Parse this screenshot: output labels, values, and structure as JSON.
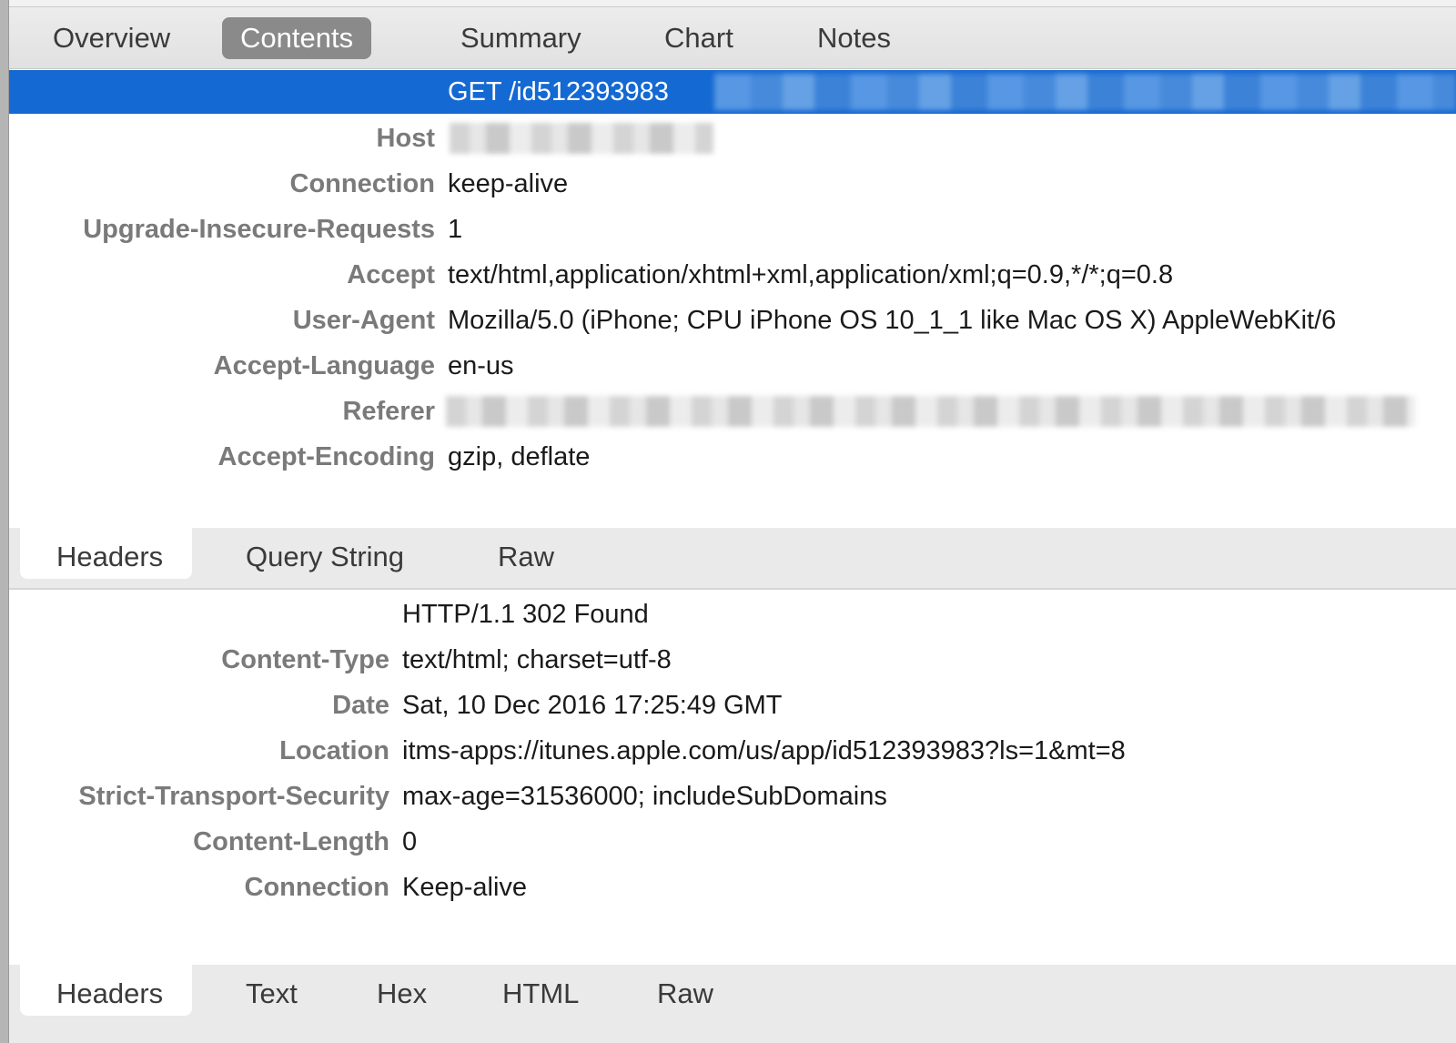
{
  "top_tabs": {
    "items": [
      {
        "label": "Overview",
        "active": false
      },
      {
        "label": "Contents",
        "active": true
      },
      {
        "label": "Summary",
        "active": false
      },
      {
        "label": "Chart",
        "active": false
      },
      {
        "label": "Notes",
        "active": false
      }
    ]
  },
  "request": {
    "request_line": "GET /id512393983",
    "headers": [
      {
        "key": "Host",
        "value": "",
        "redacted": true
      },
      {
        "key": "Connection",
        "value": "keep-alive"
      },
      {
        "key": "Upgrade-Insecure-Requests",
        "value": "1"
      },
      {
        "key": "Accept",
        "value": "text/html,application/xhtml+xml,application/xml;q=0.9,*/*;q=0.8"
      },
      {
        "key": "User-Agent",
        "value": "Mozilla/5.0 (iPhone; CPU iPhone OS 10_1_1 like Mac OS X) AppleWebKit/6"
      },
      {
        "key": "Accept-Language",
        "value": "en-us"
      },
      {
        "key": "Referer",
        "value": "",
        "redacted": true
      },
      {
        "key": "Accept-Encoding",
        "value": "gzip, deflate"
      }
    ],
    "tabs": [
      {
        "label": "Headers",
        "active": true
      },
      {
        "label": "Query String",
        "active": false
      },
      {
        "label": "Raw",
        "active": false
      }
    ]
  },
  "response": {
    "status_line": "HTTP/1.1 302 Found",
    "headers": [
      {
        "key": "Content-Type",
        "value": "text/html; charset=utf-8"
      },
      {
        "key": "Date",
        "value": "Sat, 10 Dec 2016 17:25:49 GMT"
      },
      {
        "key": "Location",
        "value": "itms-apps://itunes.apple.com/us/app/id512393983?ls=1&mt=8"
      },
      {
        "key": "Strict-Transport-Security",
        "value": "max-age=31536000; includeSubDomains"
      },
      {
        "key": "Content-Length",
        "value": "0"
      },
      {
        "key": "Connection",
        "value": "Keep-alive"
      }
    ],
    "tabs": [
      {
        "label": "Headers",
        "active": true
      },
      {
        "label": "Text",
        "active": false
      },
      {
        "label": "Hex",
        "active": false
      },
      {
        "label": "HTML",
        "active": false
      },
      {
        "label": "Raw",
        "active": false
      }
    ]
  },
  "colors": {
    "selection": "#1569d2",
    "active_tab": "#8a8a8a",
    "header_key": "#7a7a7a"
  }
}
